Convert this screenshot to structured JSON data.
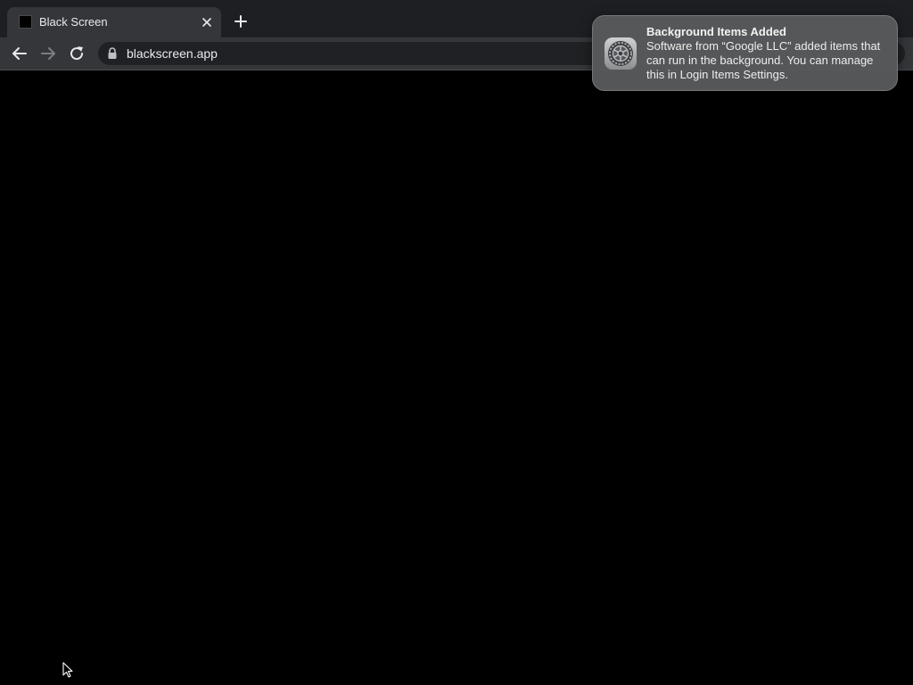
{
  "browser": {
    "tab": {
      "title": "Black Screen",
      "close_icon": "close-icon"
    },
    "new_tab_icon": "plus-icon",
    "toolbar": {
      "back_icon": "arrow-left-icon",
      "forward_icon": "arrow-right-icon",
      "reload_icon": "reload-icon",
      "lock_icon": "lock-icon",
      "url": "blackscreen.app"
    }
  },
  "page": {
    "background": "#000000"
  },
  "notification": {
    "icon": "system-settings-gear-icon",
    "title": "Background Items Added",
    "body": "Software from “Google LLC” added items that can run in the background. You can manage this in Login Items Settings."
  },
  "colors": {
    "tab_strip": "#1e1f23",
    "toolbar": "#35363a",
    "omnibox": "#202124",
    "notification_bg": "#58595b"
  }
}
